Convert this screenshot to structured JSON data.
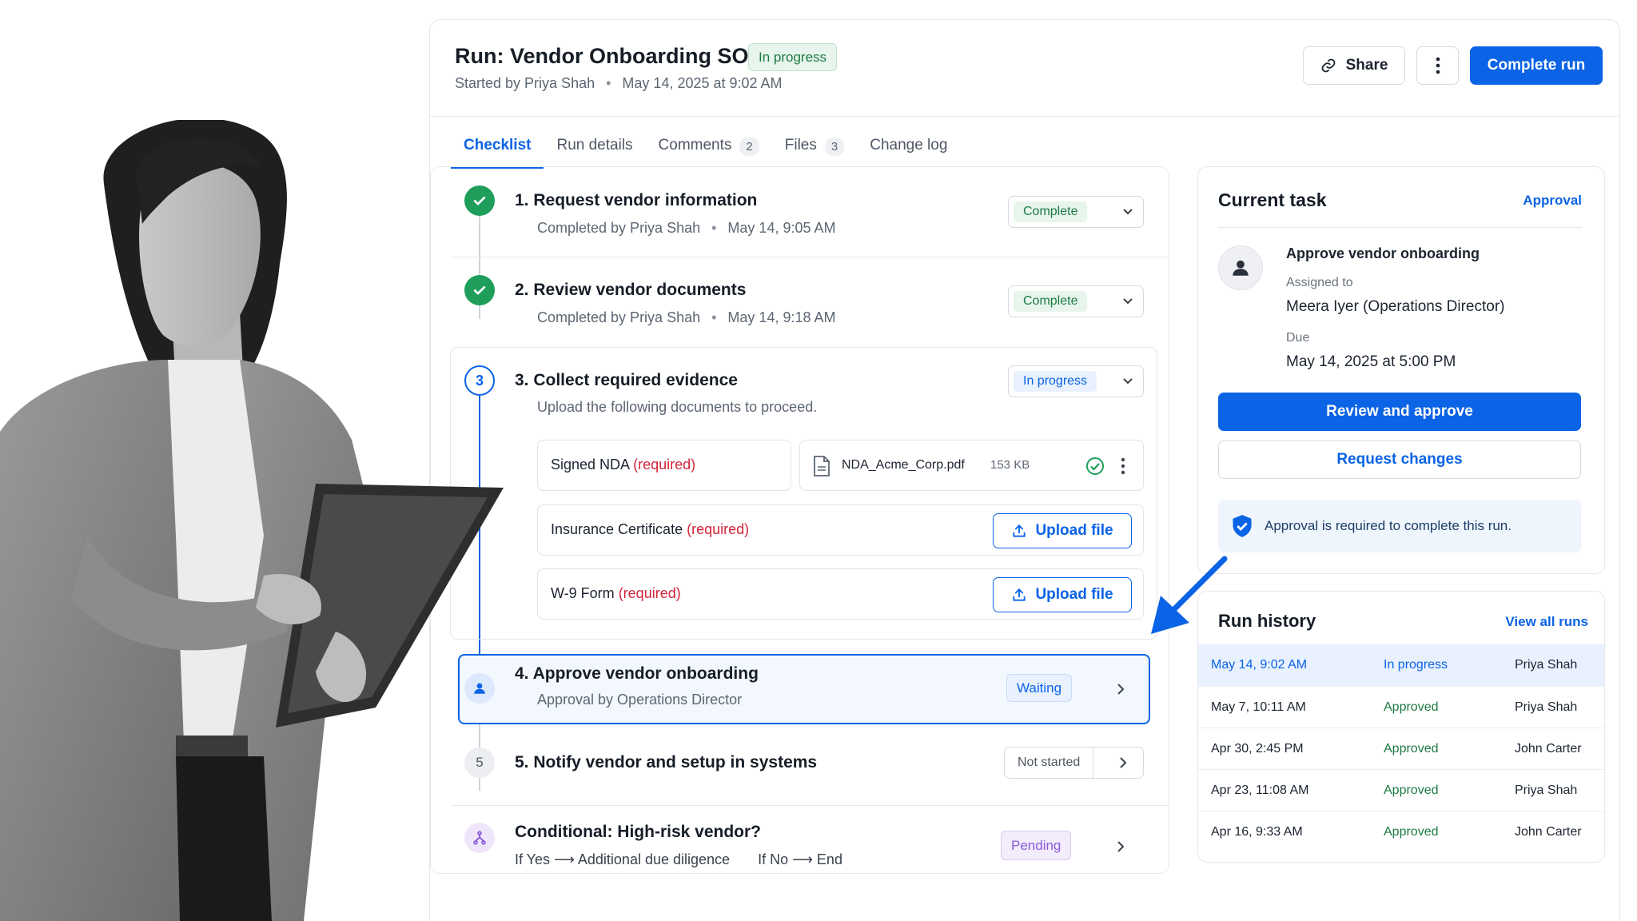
{
  "header": {
    "title": "Run: Vendor Onboarding SOP",
    "status": "In progress",
    "started_by": "Started by Priya Shah",
    "started_at": "May 14, 2025 at 9:02 AM",
    "share_label": "Share",
    "complete_label": "Complete run"
  },
  "tabs": [
    {
      "label": "Checklist",
      "count": ""
    },
    {
      "label": "Run details",
      "count": ""
    },
    {
      "label": "Comments",
      "count": "2"
    },
    {
      "label": "Files",
      "count": "3"
    },
    {
      "label": "Change log",
      "count": ""
    }
  ],
  "steps": [
    {
      "num": "1.",
      "title": "Request vendor information",
      "sub_by": "Completed by Priya Shah",
      "sub_at": "May 14, 9:05 AM",
      "status": "Complete"
    },
    {
      "num": "2.",
      "title": "Review vendor documents",
      "sub_by": "Completed by Priya Shah",
      "sub_at": "May 14, 9:18 AM",
      "status": "Complete"
    },
    {
      "num": "3.",
      "icon_num": "3",
      "title": "Collect required evidence",
      "sub": "Upload the following documents to proceed.",
      "status": "In progress"
    },
    {
      "num": "4.",
      "title": "Approve vendor onboarding",
      "sub": "Approval by Operations Director",
      "status": "Waiting"
    },
    {
      "num": "5.",
      "icon_num": "5",
      "title": "Notify vendor and setup in systems",
      "status": "Not started"
    },
    {
      "title": "Conditional: High-risk vendor?",
      "yes_label": "If Yes",
      "yes_target": "Additional due diligence",
      "no_label": "If No",
      "no_target": "End",
      "status": "Pending"
    }
  ],
  "documents": [
    {
      "name": "Signed NDA",
      "required": "(required)",
      "file": "NDA_Acme_Corp.pdf",
      "size": "153 KB"
    },
    {
      "name": "Insurance Certificate",
      "required": "(required)",
      "action": "Upload file"
    },
    {
      "name": "W-9 Form",
      "required": "(required)",
      "action": "Upload file"
    }
  ],
  "current_task": {
    "title": "Current task",
    "type_link": "Approval",
    "task_name": "Approve vendor onboarding",
    "assigned_label": "Assigned to",
    "assignee": "Meera Iyer (Operations Director)",
    "due_label": "Due",
    "due": "May 14, 2025 at 5:00 PM",
    "approve_label": "Review and approve",
    "request_label": "Request changes",
    "notice": "Approval is required to complete this run."
  },
  "history": {
    "title": "Run history",
    "link": "View all runs",
    "rows": [
      {
        "date": "May 14, 9:02 AM",
        "status": "In progress",
        "user": "Priya Shah"
      },
      {
        "date": "May 7, 10:11 AM",
        "status": "Approved",
        "user": "Priya Shah"
      },
      {
        "date": "Apr 30, 2:45 PM",
        "status": "Approved",
        "user": "John Carter"
      },
      {
        "date": "Apr 23, 11:08 AM",
        "status": "Approved",
        "user": "Priya Shah"
      },
      {
        "date": "Apr 16, 9:33 AM",
        "status": "Approved",
        "user": "John Carter"
      }
    ]
  },
  "colors": {
    "accent": "#0b63e5",
    "success": "#1e9e5a",
    "required": "#d4243a",
    "pending": "#8a5ad8"
  },
  "icons": [
    "link-icon",
    "more-vertical-icon",
    "check-circle-icon",
    "chevron-down-icon",
    "chevron-right-icon",
    "file-icon",
    "upload-icon",
    "user-icon",
    "branch-icon",
    "shield-check-icon",
    "arrow-right-icon"
  ]
}
